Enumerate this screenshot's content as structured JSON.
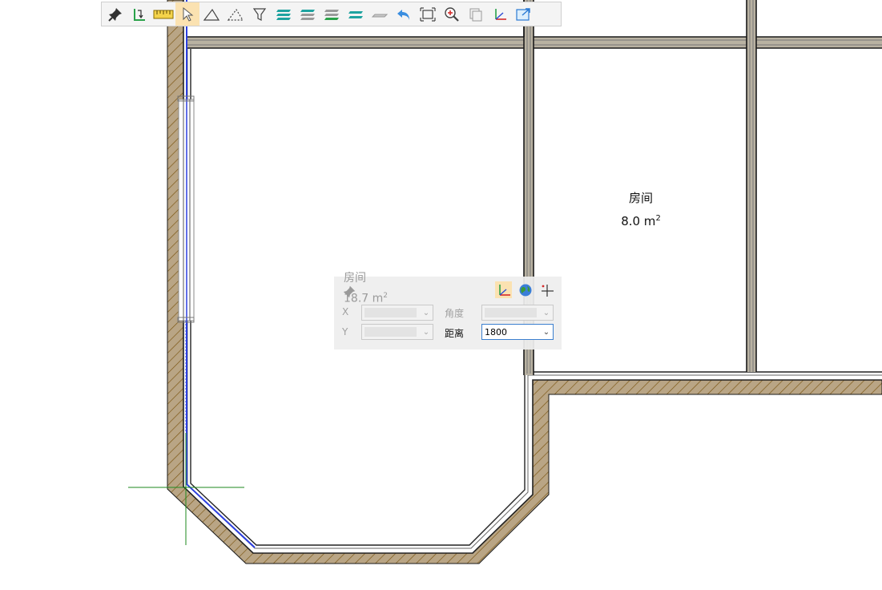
{
  "toolbar": {
    "buttons": [
      {
        "name": "pin-tool-button",
        "icon": "pushpin-icon",
        "active": false
      },
      {
        "name": "snap-tool-button",
        "icon": "snap-corner-icon",
        "active": false
      },
      {
        "name": "measure-tool-button",
        "icon": "ruler-icon",
        "active": false
      },
      {
        "name": "select-tool-button",
        "icon": "cursor-arrow-icon",
        "active": true
      },
      {
        "name": "triangle-tool-button",
        "icon": "triangle-icon",
        "active": false
      },
      {
        "name": "dashed-triangle-tool-button",
        "icon": "dashed-triangle-icon",
        "active": false
      },
      {
        "name": "filter-tool-button",
        "icon": "funnel-icon",
        "active": false
      },
      {
        "name": "layers-all-button",
        "icon": "layers-teal-icon",
        "active": false
      },
      {
        "name": "layers-gray-button",
        "icon": "layers-gray-icon",
        "active": false
      },
      {
        "name": "layers-green-button",
        "icon": "layers-green-icon",
        "active": false
      },
      {
        "name": "layers-two-button",
        "icon": "layers-two-icon",
        "active": false
      },
      {
        "name": "plane-button",
        "icon": "plane-icon",
        "active": false
      },
      {
        "name": "undo-button",
        "icon": "undo-arrow-icon",
        "active": false
      },
      {
        "name": "zoom-extents-button",
        "icon": "zoom-extents-icon",
        "active": false
      },
      {
        "name": "zoom-in-button",
        "icon": "magnifier-icon",
        "active": false
      },
      {
        "name": "copy-button",
        "icon": "copy-pages-icon",
        "active": false
      },
      {
        "name": "axes-button",
        "icon": "xyz-axes-icon",
        "active": false
      },
      {
        "name": "export-button",
        "icon": "export-window-icon",
        "active": false
      }
    ]
  },
  "rooms": [
    {
      "name": "房间",
      "area": "8.0 m",
      "exp": "2"
    }
  ],
  "coord_panel": {
    "faded_room_name": "房间",
    "faded_room_area": "18.7 m",
    "faded_room_exp": "2",
    "x_label": "X",
    "y_label": "Y",
    "angle_label": "角度",
    "distance_label": "距离",
    "distance_value": "1800",
    "icons": [
      "coordinate-axes-icon",
      "globe-icon",
      "crosshair-icon"
    ]
  },
  "colors": {
    "wall_fill": "#b9a585",
    "wall_hatch": "#7a5410",
    "wall_line": "#1a1a1a",
    "selection": "#2c3fe0",
    "crosshair": "#1e8a1e",
    "panel_focus": "#3b7fcf",
    "toolbar_active": "#fbe2b1"
  }
}
